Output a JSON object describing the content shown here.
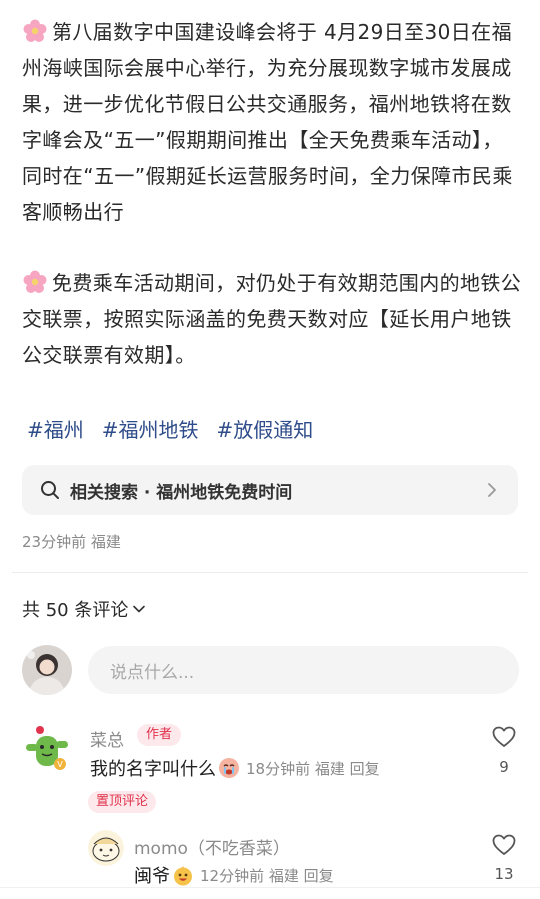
{
  "post": {
    "para1": "第八届数字中国建设峰会将于 4月29日至30日在福州海峡国际会展中心举行，为充分展现数字城市发展成果，进一步优化节假日公共交通服务，福州地铁将在数字峰会及“五一”假期期间推出【全天免费乘车活动】，同时在“五一”假期延长运营服务时间，全力保障市民乘客顺畅出行",
    "para2": "免费乘车活动期间，对仍处于有效期范围内的地铁公交联票，按照实际涵盖的免费天数对应【延长用户地铁公交联票有效期】。",
    "icon": "flower-emoji-icon"
  },
  "tags": [
    "#福州",
    "#福州地铁",
    "#放假通知"
  ],
  "related_search": {
    "label": "相关搜索 · 福州地铁免费时间"
  },
  "meta": "23分钟前 福建",
  "comments_header": {
    "count_label": "共 50 条评论"
  },
  "comment_input": {
    "placeholder": "说点什么..."
  },
  "comments": [
    {
      "name": "菜总",
      "badge": "作者",
      "text": "我的名字叫什么",
      "sub": "18分钟前 福建 回复",
      "pinned_label": "置顶评论",
      "likes": "9"
    },
    {
      "name": "momo（不吃香菜）",
      "text": "闽爷",
      "sub": "12分钟前 福建 回复",
      "likes": "13"
    }
  ],
  "colors": {
    "tag": "#2f4d8a",
    "accent": "#e0324b",
    "muted": "#8a8a8a"
  }
}
